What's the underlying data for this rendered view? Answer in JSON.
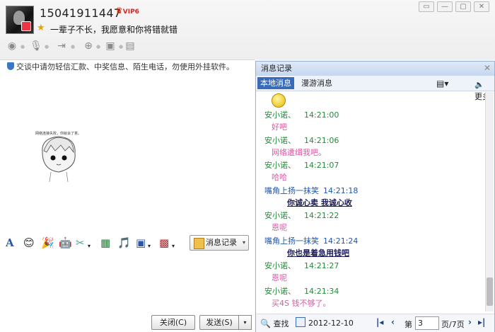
{
  "header": {
    "contact_name": "15041911447",
    "vip_label": "VIP6",
    "signature": "一辈子不长，我愿意和你将错就错",
    "window_buttons": [
      "☐",
      "☐",
      "☐",
      "☐"
    ]
  },
  "chat": {
    "security_notice": "交谈中请勿轻信汇款、中奖信息、陌生电话，勿使用外挂软件。",
    "sticker_caption": "网络连接失败，你就会了意。",
    "history_button": "消息记录",
    "close_button": "关闭(C)",
    "send_button": "发送(S)"
  },
  "history": {
    "title": "消息记录",
    "tab_local": "本地消息",
    "tab_roam": "漫游消息",
    "more_label": "更多",
    "messages": [
      {
        "kind": "emoji"
      },
      {
        "kind": "header",
        "color": "green",
        "sender": "安小诺、",
        "time": "14:21:00"
      },
      {
        "kind": "body",
        "style": "pink",
        "text": "好吧"
      },
      {
        "kind": "header",
        "color": "green",
        "sender": "安小诺、",
        "time": "14:21:06"
      },
      {
        "kind": "body",
        "style": "pink",
        "text": "网络遭缉我吧。"
      },
      {
        "kind": "header",
        "color": "green",
        "sender": "安小诺、",
        "time": "14:21:07"
      },
      {
        "kind": "body",
        "style": "pink",
        "text": "哈哈"
      },
      {
        "kind": "header",
        "color": "blue",
        "sender": "嘴角上扬一抹笑",
        "time": "14:21:18"
      },
      {
        "kind": "body",
        "style": "bold",
        "text": "你诚心卖 我诚心收"
      },
      {
        "kind": "header",
        "color": "green",
        "sender": "安小诺、",
        "time": "14:21:22"
      },
      {
        "kind": "body",
        "style": "pink",
        "text": "恩呢"
      },
      {
        "kind": "header",
        "color": "blue",
        "sender": "嘴角上扬一抹笑",
        "time": "14:21:24"
      },
      {
        "kind": "body",
        "style": "bold",
        "text": "你也是着急用钱吧"
      },
      {
        "kind": "header",
        "color": "green",
        "sender": "安小诺、",
        "time": "14:21:27"
      },
      {
        "kind": "body",
        "style": "pink",
        "text": "恩呢"
      },
      {
        "kind": "header",
        "color": "green",
        "sender": "安小诺、",
        "time": "14:21:34"
      },
      {
        "kind": "body",
        "style": "pink",
        "text": "买4S 钱不够了。"
      }
    ],
    "search_label": "查找",
    "date": "2012-12-10",
    "page_label": "第",
    "page_value": "3",
    "page_total": "页/7页"
  },
  "colors": {
    "green_sender": "#228b3a",
    "blue_sender": "#1f56a8",
    "pink_text": "#d85aa4",
    "accent": "#3a6bb8"
  }
}
